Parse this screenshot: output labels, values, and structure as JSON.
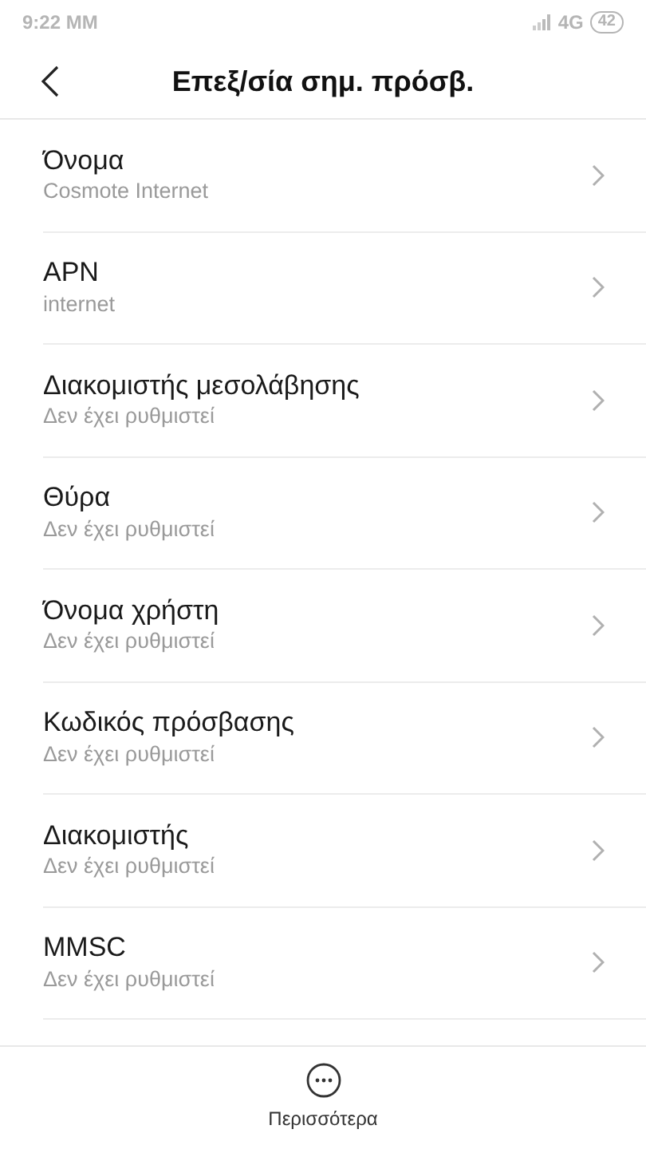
{
  "status_bar": {
    "time": "9:22 MM",
    "network": "4G",
    "battery": "42"
  },
  "header": {
    "title": "Επεξ/σία σημ. πρόσβ."
  },
  "items": [
    {
      "title": "Όνομα",
      "value": "Cosmote Internet"
    },
    {
      "title": "APN",
      "value": "internet"
    },
    {
      "title": "Διακομιστής μεσολάβησης",
      "value": "Δεν έχει ρυθμιστεί"
    },
    {
      "title": "Θύρα",
      "value": "Δεν έχει ρυθμιστεί"
    },
    {
      "title": "Όνομα χρήστη",
      "value": "Δεν έχει ρυθμιστεί"
    },
    {
      "title": "Κωδικός πρόσβασης",
      "value": "Δεν έχει ρυθμιστεί"
    },
    {
      "title": "Διακομιστής",
      "value": "Δεν έχει ρυθμιστεί"
    },
    {
      "title": "MMSC",
      "value": "Δεν έχει ρυθμιστεί"
    }
  ],
  "footer": {
    "label": "Περισσότερα"
  }
}
